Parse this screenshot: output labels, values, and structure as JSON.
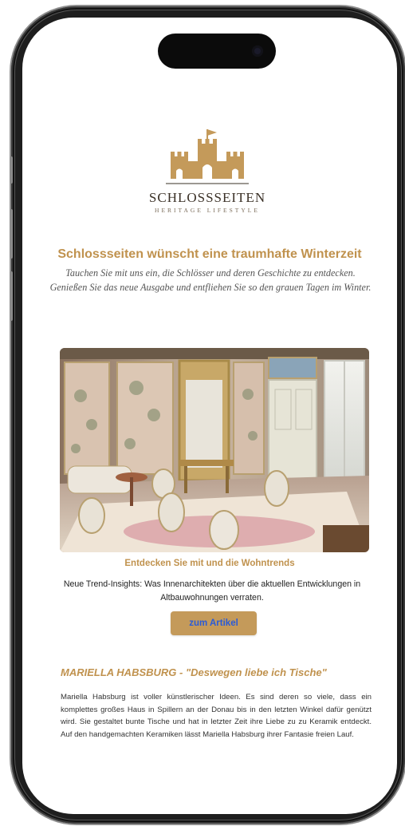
{
  "newsletter": {
    "logo": {
      "brand": "SCHLOSSSEITEN",
      "tagline": "HERITAGE LIFESTYLE",
      "accent_color": "#c49a5a"
    },
    "headline": "Schlossseiten wünscht eine traumhafte Winterzeit",
    "intro": "Tauchen Sie mit uns ein, die Schlösser und deren Geschichte zu entdecken. Genießen Sie das neue Ausgabe und entfliehen Sie so den grauen Tagen im Winter.",
    "feature": {
      "title": "Entdecken Sie mit und die Wohntrends",
      "text": "Neue Trend-Insights: Was Innenarchitekten über die aktuellen Entwicklungen in Altbauwohnungen verraten.",
      "button_label": "zum Artikel",
      "button_color": "#c49a5a",
      "button_text_color": "#2a5bd7"
    },
    "article": {
      "title": "MARIELLA HABSBURG - \"Deswegen liebe ich Tische\"",
      "text": "Mariella Habsburg ist voller künstlerischer Ideen. Es sind deren so viele, dass ein komplettes großes Haus in Spillern an der Donau bis in den letzten Winkel dafür genützt wird. Sie gestaltet bunte Tische und hat in letzter Zeit ihre Liebe zu zu Keramik entdeckt. Auf den handgemachten Keramiken lässt Mariella Habsburg ihrer Fantasie freien Lauf."
    },
    "title_color": "#c0924e"
  }
}
